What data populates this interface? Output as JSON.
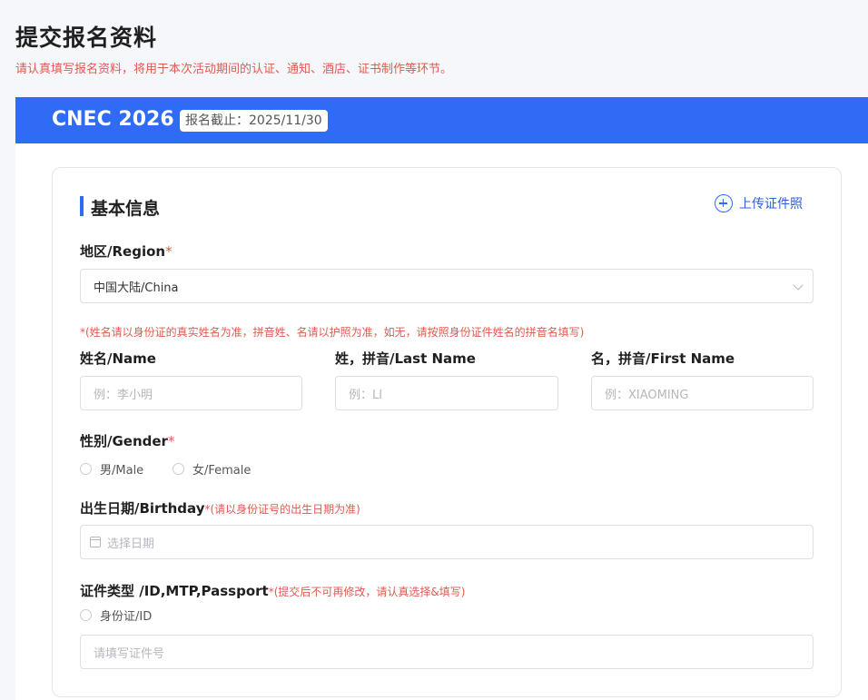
{
  "page": {
    "title": "提交报名资料",
    "subtitle": "请认真填写报名资料，将用于本次活动期间的认证、通知、酒店、证书制作等环节。"
  },
  "banner": {
    "event_name": "CNEC 2026",
    "deadline": "报名截止：2025/11/30"
  },
  "section": {
    "title": "基本信息",
    "upload_label": "上传证件照"
  },
  "form": {
    "required_mark": "*",
    "region": {
      "label": "地区/Region",
      "value": "中国大陆/China"
    },
    "name_note": "*(姓名请以身份证的真实姓名为准，拼音姓、名请以护照为准，如无，请按照身份证件姓名的拼音名填写)",
    "full_name": {
      "label": "姓名/Name",
      "placeholder": "例：李小明"
    },
    "last_name": {
      "label": "姓，拼音/Last Name",
      "placeholder": "例：LI"
    },
    "first_name": {
      "label": "名，拼音/First Name",
      "placeholder": "例：XIAOMING"
    },
    "gender": {
      "label": "性别/Gender",
      "options": [
        "男/Male",
        "女/Female"
      ]
    },
    "birthday": {
      "label": "出生日期/Birthday",
      "hint": "*(请以身份证号的出生日期为准)",
      "placeholder": "选择日期"
    },
    "id_type": {
      "label": "证件类型 /ID,MTP,Passport",
      "hint": "*(提交后不可再修改，请认真选择&填写)",
      "options": [
        "身份证/ID"
      ],
      "placeholder": "请填写证件号"
    }
  },
  "colors": {
    "accent": "#2f6bf5",
    "warning": "#e05a4f",
    "background": "#f5f7fa"
  }
}
